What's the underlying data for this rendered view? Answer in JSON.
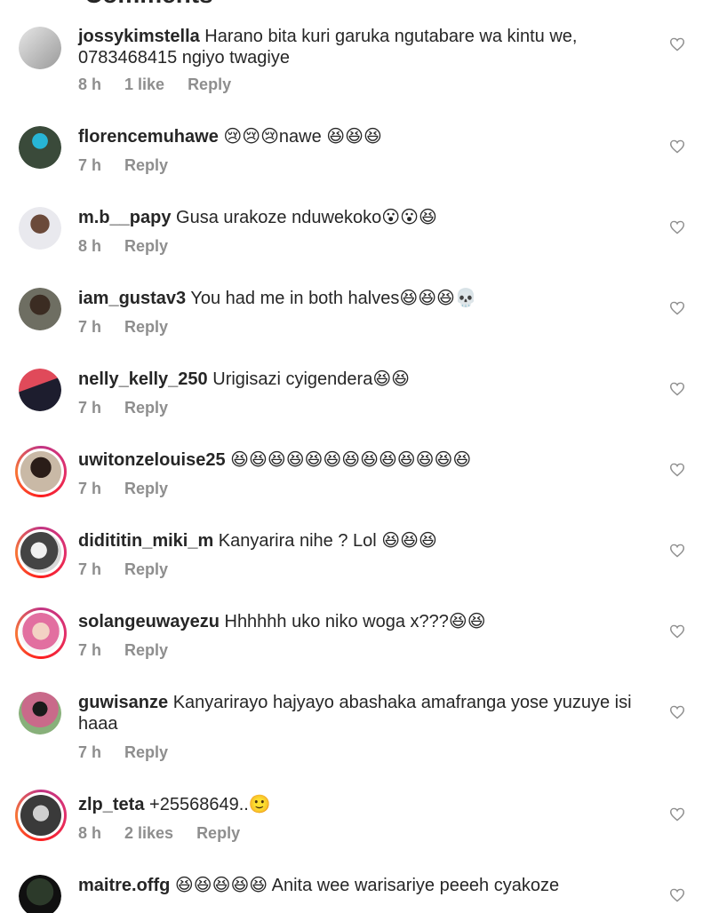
{
  "header": {
    "title": "Comments"
  },
  "comments": [
    {
      "username": "jossykimstella",
      "text": " Harano bita kuri garuka ngutabare wa kintu we, 0783468415 ngiyo twagiye",
      "time": "8 h",
      "likes": "1 like",
      "reply": "Reply"
    },
    {
      "username": "florencemuhawe",
      "text": " 😢😢😢nawe 😆😆😆",
      "time": "7 h",
      "likes": "",
      "reply": "Reply"
    },
    {
      "username": "m.b__papy",
      "text": " Gusa urakoze nduwekoko😮😮😆",
      "time": "8 h",
      "likes": "",
      "reply": "Reply"
    },
    {
      "username": "iam_gustav3",
      "text": " You had me in both halves😆😆😆💀",
      "time": "7 h",
      "likes": "",
      "reply": "Reply"
    },
    {
      "username": "nelly_kelly_250",
      "text": " Urigisazi cyigendera😆😆",
      "time": "7 h",
      "likes": "",
      "reply": "Reply"
    },
    {
      "username": "uwitonzelouise25",
      "text": " 😆😆😆😆😆😆😆😆😆😆😆😆😆",
      "time": "7 h",
      "likes": "",
      "reply": "Reply"
    },
    {
      "username": "didititin_miki_m",
      "text": " Kanyarira nihe ? Lol 😆😆😆",
      "time": "7 h",
      "likes": "",
      "reply": "Reply"
    },
    {
      "username": "solangeuwayezu",
      "text": " Hhhhhh uko niko woga x???😆😆",
      "time": "7 h",
      "likes": "",
      "reply": "Reply"
    },
    {
      "username": "guwisanze",
      "text": " Kanyarirayo hajyayo abashaka amafranga yose yuzuye isi haaa",
      "time": "7 h",
      "likes": "",
      "reply": "Reply"
    },
    {
      "username": "zlp_teta",
      "text": " +25568649..🙂",
      "time": "8 h",
      "likes": "2 likes",
      "reply": "Reply"
    },
    {
      "username": "maitre.offg",
      "text": " 😆😆😆😆😆 Anita wee warisariye peeeh cyakoze",
      "time": "",
      "likes": "",
      "reply": ""
    }
  ],
  "colors": {
    "text": "#262626",
    "meta": "#8e8e8e",
    "story_ring": "#e1306c"
  },
  "icons": {
    "back": "back-arrow-icon",
    "send": "send-icon",
    "like": "heart-icon"
  }
}
